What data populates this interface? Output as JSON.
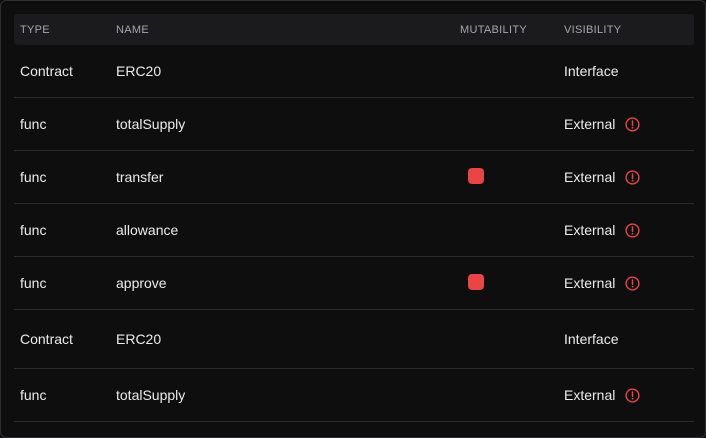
{
  "columns": {
    "type": "TYPE",
    "name": "NAME",
    "mutability": "MUTABILITY",
    "visibility": "VISIBILITY"
  },
  "colors": {
    "mutability_badge": "#e94545",
    "warning_icon": "#e94545"
  },
  "rows": [
    {
      "type": "Contract",
      "name": "ERC20",
      "mutable": false,
      "visibility": "Interface",
      "warning": false
    },
    {
      "type": "func",
      "name": "totalSupply",
      "mutable": false,
      "visibility": "External",
      "warning": true
    },
    {
      "type": "func",
      "name": "transfer",
      "mutable": true,
      "visibility": "External",
      "warning": true
    },
    {
      "type": "func",
      "name": "allowance",
      "mutable": false,
      "visibility": "External",
      "warning": true
    },
    {
      "type": "func",
      "name": "approve",
      "mutable": true,
      "visibility": "External",
      "warning": true
    },
    {
      "type": "Contract",
      "name": "ERC20",
      "mutable": false,
      "visibility": "Interface",
      "warning": false
    },
    {
      "type": "func",
      "name": "totalSupply",
      "mutable": false,
      "visibility": "External",
      "warning": true
    }
  ]
}
